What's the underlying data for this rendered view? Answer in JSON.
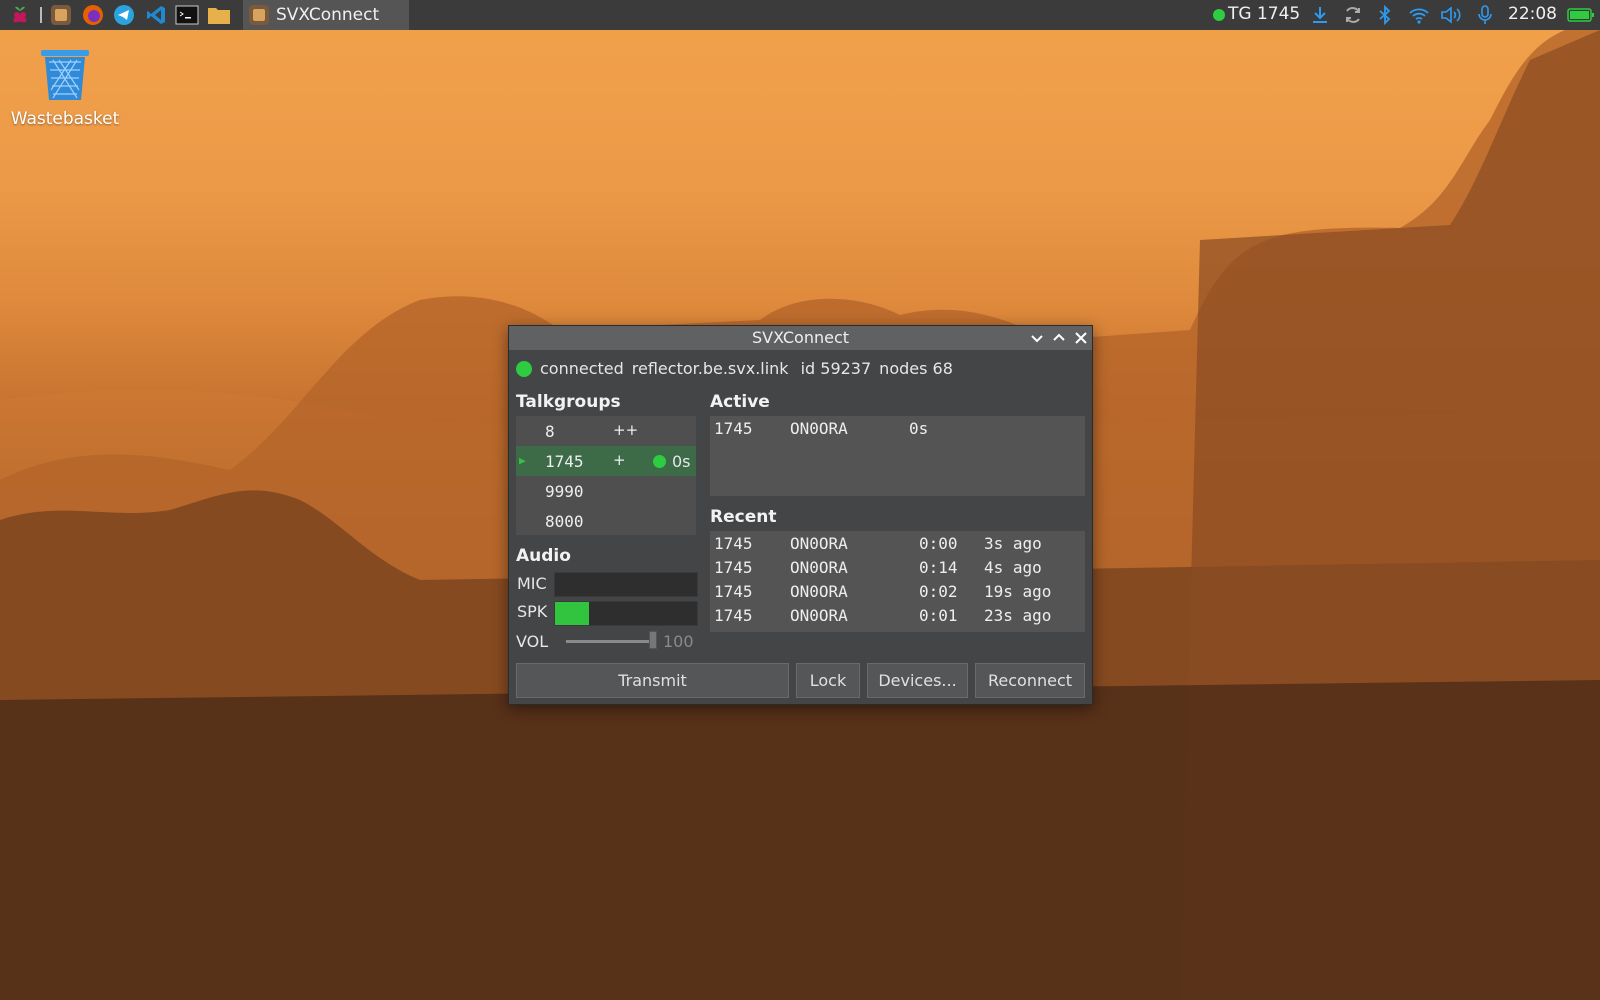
{
  "taskbar": {
    "task_label": "SVXConnect",
    "tg_status": "TG 1745",
    "clock": "22:08"
  },
  "desktop": {
    "wastebasket_label": "Wastebasket"
  },
  "window": {
    "title": "SVXConnect",
    "status": {
      "state": "connected",
      "host": "reflector.be.svx.link",
      "id": "id 59237",
      "nodes": "nodes 68"
    },
    "talkgroups_title": "Talkgroups",
    "talkgroups": [
      {
        "num": "8",
        "flag": "++"
      },
      {
        "num": "1745",
        "flag": "+",
        "activity": "0s"
      },
      {
        "num": "9990",
        "flag": ""
      },
      {
        "num": "8000",
        "flag": ""
      }
    ],
    "active_title": "Active",
    "active": [
      {
        "tg": "1745",
        "call": "ON0ORA",
        "time": "0s"
      }
    ],
    "recent_title": "Recent",
    "recent": [
      {
        "tg": "1745",
        "call": "ON0ORA",
        "dur": "0:00",
        "ago": "3s ago"
      },
      {
        "tg": "1745",
        "call": "ON0ORA",
        "dur": "0:14",
        "ago": "4s ago"
      },
      {
        "tg": "1745",
        "call": "ON0ORA",
        "dur": "0:02",
        "ago": "19s ago"
      },
      {
        "tg": "1745",
        "call": "ON0ORA",
        "dur": "0:01",
        "ago": "23s ago"
      }
    ],
    "audio_title": "Audio",
    "mic_label": "MIC",
    "spk_label": "SPK",
    "vol_label": "VOL",
    "vol_value": "100",
    "mic_level": 0,
    "spk_level": 0.24,
    "buttons": {
      "transmit": "Transmit",
      "lock": "Lock",
      "devices": "Devices...",
      "reconnect": "Reconnect"
    }
  },
  "colors": {
    "accent_green": "#2ecc40",
    "selected_row": "#3d6b47"
  }
}
